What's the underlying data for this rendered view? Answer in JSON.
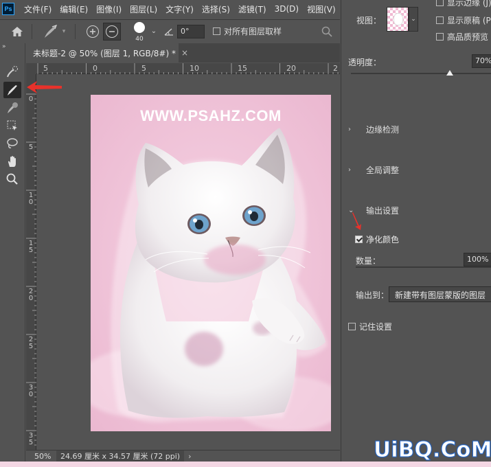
{
  "app": {
    "logo_text": "Ps"
  },
  "menubar": {
    "items": [
      "文件(F)",
      "编辑(E)",
      "图像(I)",
      "图层(L)",
      "文字(Y)",
      "选择(S)",
      "滤镜(T)",
      "3D(D)",
      "视图(V)"
    ]
  },
  "options": {
    "brush_size": "40",
    "angle": "0°",
    "sample_all_layers_label": "对所有图层取样",
    "sample_all_layers_checked": false
  },
  "document": {
    "tab_title": "未标题-2 @ 50% (图层 1, RGB/8#) *",
    "close_glyph": "×",
    "watermark": "WWW.PSAHZ.COM",
    "zoom": "50%",
    "size_info": "24.69 厘米 x 34.57 厘米 (72 ppi)",
    "status_chevron": "›"
  },
  "ruler": {
    "h_labels": [
      "5",
      "0",
      "5",
      "10",
      "15",
      "20",
      "2"
    ],
    "v_labels": [
      "0",
      "5",
      "1\n0",
      "1\n5",
      "2\n0",
      "2\n5",
      "3\n0",
      "3\n5"
    ]
  },
  "panel": {
    "view_label": "视图：",
    "show_edge_label": "显示边缘 (J)",
    "show_original_label": "显示原稿 (P)",
    "hq_preview_label": "高品质预览",
    "opacity_label": "透明度：",
    "opacity_value": "70%",
    "opacity_fraction": 0.7,
    "sections": {
      "edge_detection": "边缘检测",
      "global_refine": "全局调整",
      "output_settings": "输出设置"
    },
    "decontaminate_label": "净化颜色",
    "decontaminate_checked": true,
    "amount_label": "数量：",
    "amount_value": "100%",
    "output_to_label": "输出到：",
    "output_to_value": "新建带有图层蒙版的图层",
    "remember_label": "记住设置",
    "remember_checked": false
  },
  "overlay": {
    "brand_text": "UiBQ.CoM",
    "arrow_color": "#e8322b"
  },
  "colors": {
    "accent": "#31a8ff",
    "canvas_bg": "#f2c7dc",
    "ui_bg": "#535353"
  }
}
